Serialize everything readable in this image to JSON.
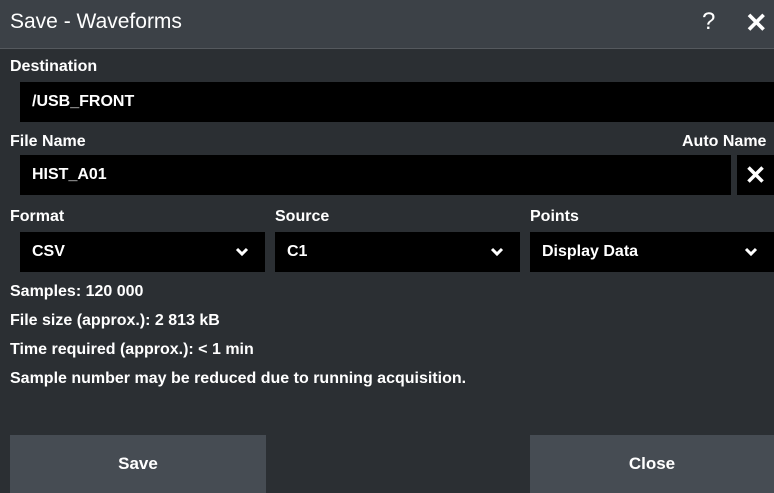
{
  "window": {
    "title": "Save - Waveforms",
    "help_icon": "?",
    "close_icon": "✕"
  },
  "destination": {
    "label": "Destination",
    "value": "/USB_FRONT"
  },
  "file_name": {
    "label": "File Name",
    "value": "HIST_A01",
    "auto_name_label": "Auto Name",
    "clear_icon": "✕"
  },
  "format": {
    "label": "Format",
    "value": "CSV"
  },
  "source": {
    "label": "Source",
    "value": "C1"
  },
  "points": {
    "label": "Points",
    "value": "Display Data"
  },
  "info": {
    "samples": "Samples: 120 000",
    "file_size": "File size (approx.): 2 813 kB",
    "time_required": "Time required (approx.): < 1 min",
    "note": "Sample number may be reduced due to running acquisition."
  },
  "buttons": {
    "save": "Save",
    "close": "Close"
  },
  "icons": {
    "dropdown": "chevron-down-icon",
    "chevron_glyph": "⌄"
  },
  "colors": {
    "background": "#2b2f33",
    "titlebar": "#3c4147",
    "field": "#000000",
    "button": "#464c53"
  }
}
